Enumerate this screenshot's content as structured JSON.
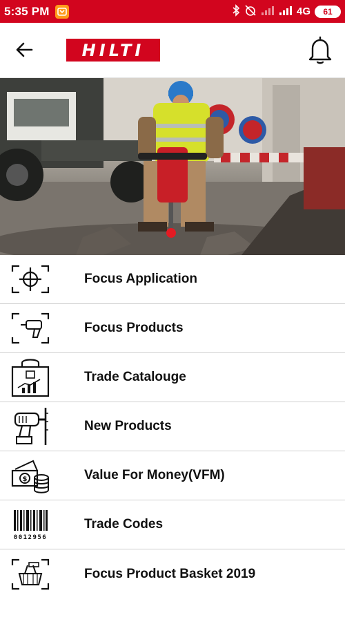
{
  "status_bar": {
    "time": "5:35 PM",
    "network": "4G",
    "battery": "61",
    "icons": [
      "bluetooth-icon",
      "alarm-off-icon",
      "signal-icon",
      "signal-icon"
    ]
  },
  "header": {
    "logo_text": "HILTI",
    "back_icon": "arrow-left-icon",
    "notification_icon": "bell-icon"
  },
  "hero": {
    "description_icon": "worker-with-jackhammer-photo"
  },
  "menu": {
    "items": [
      {
        "label": "Focus Application",
        "icon": "crosshair-focus-icon"
      },
      {
        "label": "Focus Products",
        "icon": "drill-focus-icon"
      },
      {
        "label": "Trade Catalouge",
        "icon": "shopping-bag-chart-icon"
      },
      {
        "label": "New Products",
        "icon": "power-drill-icon"
      },
      {
        "label": "Value For Money(VFM)",
        "icon": "money-coins-icon"
      },
      {
        "label": "Trade Codes",
        "icon": "barcode-icon",
        "barcode_number": "0012956"
      },
      {
        "label": "Focus Product Basket 2019",
        "icon": "basket-focus-icon"
      }
    ]
  },
  "colors": {
    "brand_red": "#d2051e",
    "text": "#111111",
    "divider": "#cfcfcf"
  }
}
